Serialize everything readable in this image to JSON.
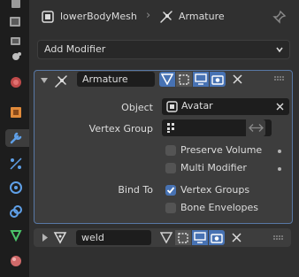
{
  "header": {
    "object_name": "lowerBodyMesh",
    "separator": "›",
    "data_name": "Armature"
  },
  "add_modifier": {
    "label": "Add Modifier"
  },
  "modifiers": [
    {
      "name": "Armature",
      "expanded": true,
      "fields": {
        "object_label": "Object",
        "object_value": "Avatar",
        "vertex_group_label": "Vertex Group",
        "vertex_group_value": ""
      },
      "options": {
        "preserve_volume_label": "Preserve Volume",
        "preserve_volume": false,
        "multi_modifier_label": "Multi Modifier",
        "multi_modifier": false
      },
      "bind_to": {
        "label": "Bind To",
        "vertex_groups_label": "Vertex Groups",
        "vertex_groups": true,
        "bone_envelopes_label": "Bone Envelopes",
        "bone_envelopes": false
      }
    },
    {
      "name": "weld",
      "expanded": false
    }
  ],
  "colors": {
    "accent": "#4772b3",
    "panel_outline": "#5878a5"
  },
  "icons": {
    "tabs": [
      "tool-icon",
      "render-icon",
      "output-icon",
      "view-layer-icon",
      "scene-icon",
      "world-icon",
      "object-icon",
      "modifier-icon",
      "particles-icon",
      "physics-icon",
      "constraints-icon",
      "object-data-icon",
      "material-icon"
    ]
  }
}
